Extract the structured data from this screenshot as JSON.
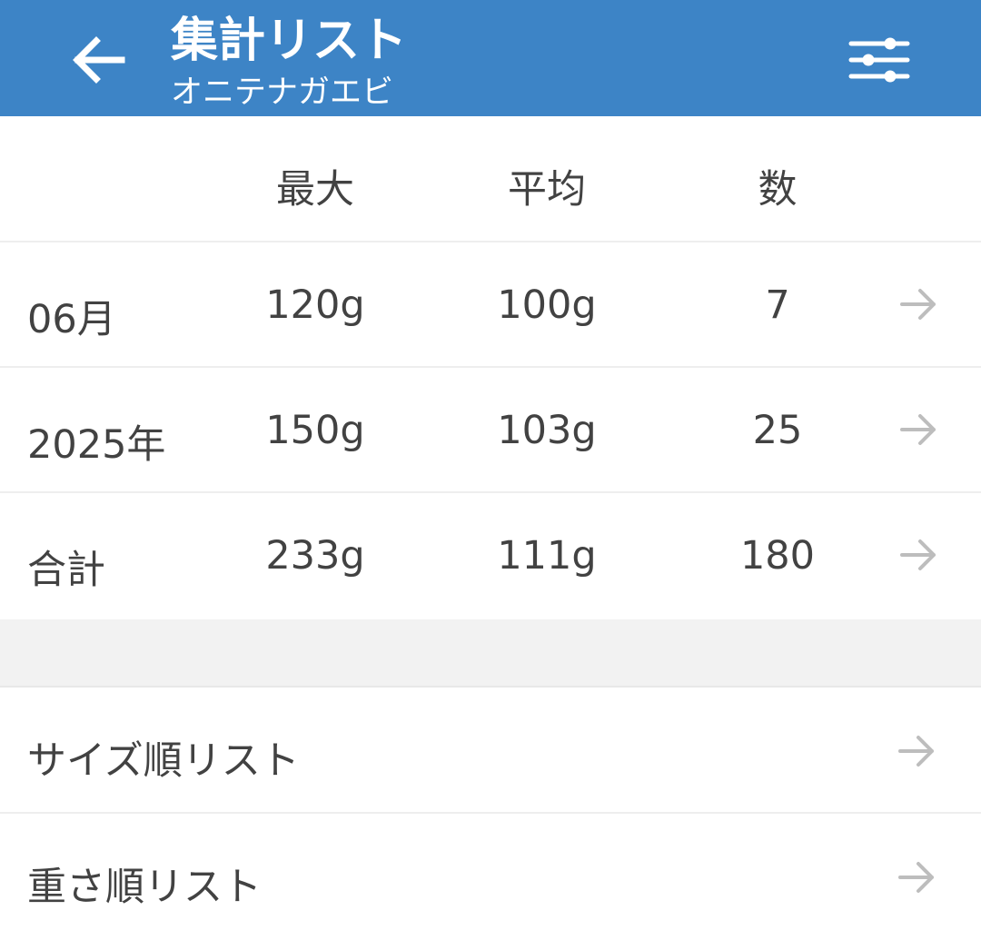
{
  "appbar": {
    "title": "集計リスト",
    "subtitle": "オニテナガエビ",
    "back_icon": "arrow-left-icon",
    "filter_icon": "sliders-icon",
    "color": "#3d84c6"
  },
  "table": {
    "headers": [
      "",
      "最大",
      "平均",
      "数"
    ],
    "rows": [
      {
        "label": "06月",
        "max": "120g",
        "avg": "100g",
        "count": "7"
      },
      {
        "label": "2025年",
        "max": "150g",
        "avg": "103g",
        "count": "25"
      },
      {
        "label": "合計",
        "max": "233g",
        "avg": "111g",
        "count": "180"
      }
    ],
    "row_icon": "arrow-right-icon"
  },
  "lists": {
    "items": [
      {
        "label": "サイズ順リスト"
      },
      {
        "label": "重さ順リスト"
      }
    ]
  }
}
